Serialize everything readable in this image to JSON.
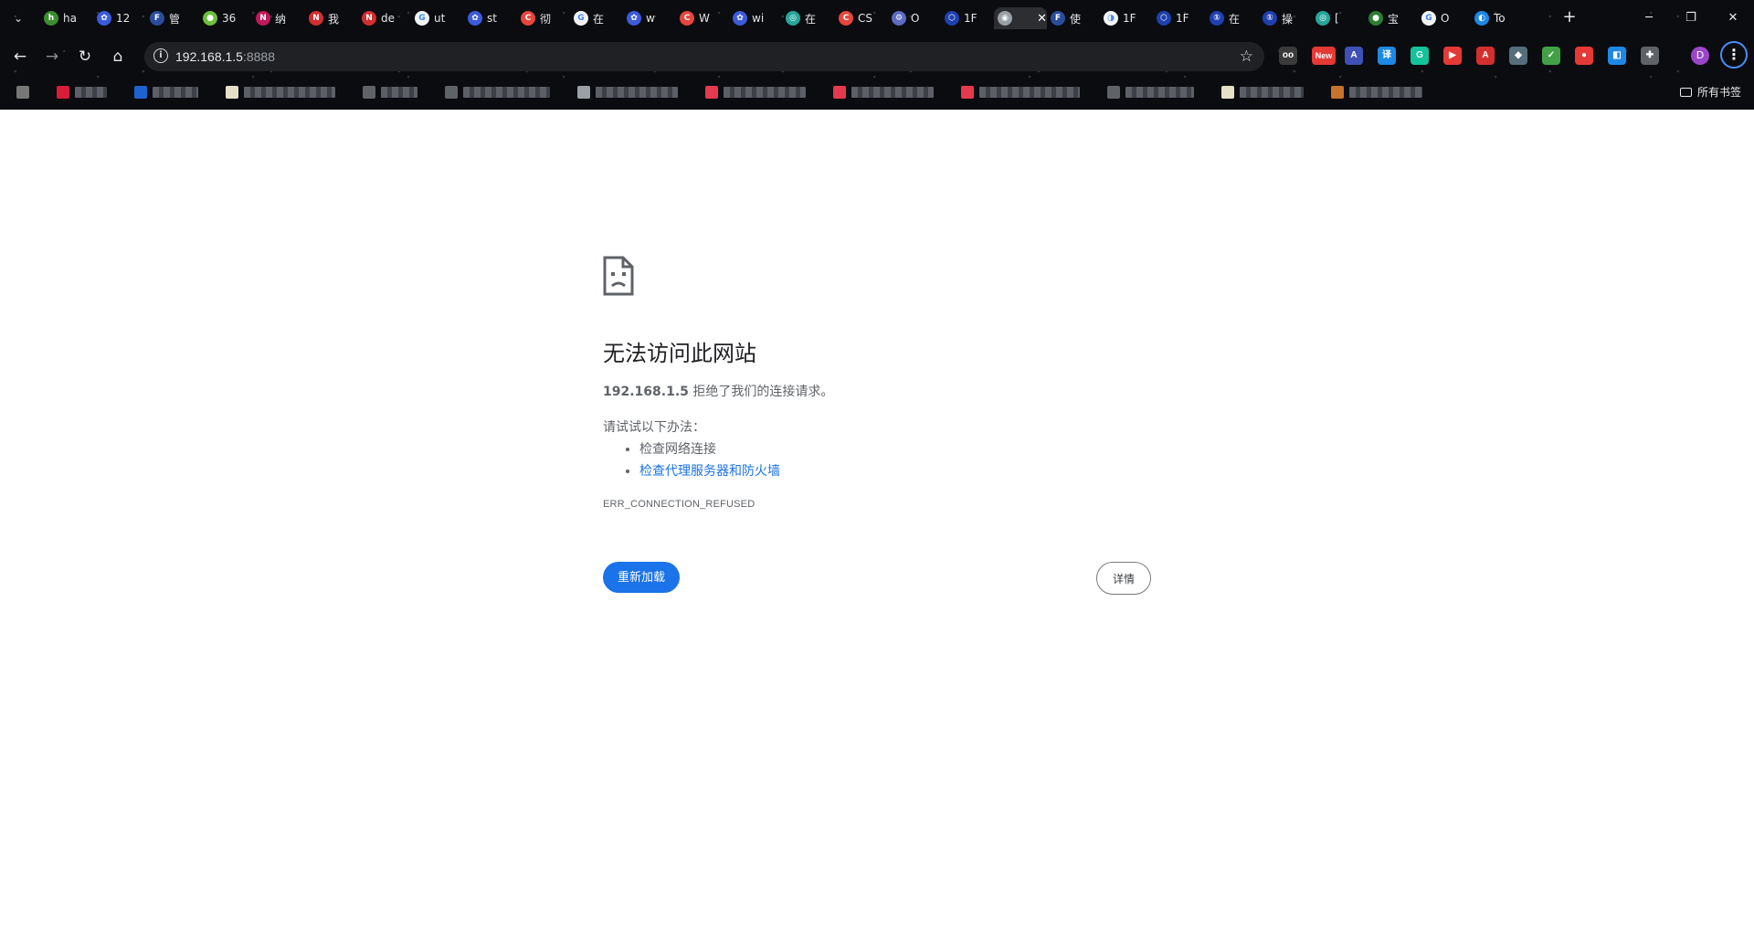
{
  "window": {
    "minimize_icon": "─",
    "restore_icon": "❐",
    "close_icon": "✕"
  },
  "tabs": [
    {
      "title": "ha",
      "color": "#3c8d2f",
      "glyph": "h"
    },
    {
      "title": "12",
      "color": "#3b5bdb",
      "glyph": "✿"
    },
    {
      "title": "管",
      "color": "#2a4d9b",
      "glyph": "F"
    },
    {
      "title": "36",
      "color": "#6bbf3b",
      "glyph": "●"
    },
    {
      "title": "纳",
      "color": "#c2185b",
      "glyph": "N"
    },
    {
      "title": "我",
      "color": "#d32f2f",
      "glyph": "N"
    },
    {
      "title": "de",
      "color": "#d32f2f",
      "glyph": "N"
    },
    {
      "title": "ut",
      "color": "#f1f3f4",
      "glyph": "G"
    },
    {
      "title": "st",
      "color": "#3b5bdb",
      "glyph": "✿"
    },
    {
      "title": "彻",
      "color": "#e8453c",
      "glyph": "C"
    },
    {
      "title": "在",
      "color": "#f1f3f4",
      "glyph": "G"
    },
    {
      "title": "w",
      "color": "#3b5bdb",
      "glyph": "✿"
    },
    {
      "title": "W",
      "color": "#e8453c",
      "glyph": "C"
    },
    {
      "title": "wi",
      "color": "#3b5bdb",
      "glyph": "✿"
    },
    {
      "title": "在",
      "color": "#26a69a",
      "glyph": "◎"
    },
    {
      "title": "CS",
      "color": "#e8453c",
      "glyph": "C"
    },
    {
      "title": "O",
      "color": "#5c6bc0",
      "glyph": "⚙"
    },
    {
      "title": "1F",
      "color": "#1e40af",
      "glyph": "⬡"
    },
    {
      "title": "",
      "color": "#9aa0a6",
      "glyph": "◉",
      "active": true
    },
    {
      "title": "使",
      "color": "#2a4d9b",
      "glyph": "F"
    },
    {
      "title": "1F",
      "color": "#f1f3f4",
      "glyph": "◑"
    },
    {
      "title": "1F",
      "color": "#1e40af",
      "glyph": "⬡"
    },
    {
      "title": "在",
      "color": "#1e40af",
      "glyph": "①"
    },
    {
      "title": "操",
      "color": "#1e40af",
      "glyph": "①"
    },
    {
      "title": "[",
      "color": "#26a69a",
      "glyph": "◎"
    },
    {
      "title": "宝",
      "color": "#2e7d32",
      "glyph": "●"
    },
    {
      "title": "O",
      "color": "#f1f3f4",
      "glyph": "G"
    },
    {
      "title": "To",
      "color": "#1e88e5",
      "glyph": "◐"
    }
  ],
  "new_tab_icon": "+",
  "omnibox": {
    "host": "192.168.1.5",
    "port": ":8888"
  },
  "extensions": [
    {
      "glyph": "oo",
      "color": "#3a3a3a"
    },
    {
      "glyph": "New",
      "color": "#e53935"
    },
    {
      "glyph": "A",
      "color": "#3f51b5"
    },
    {
      "glyph": "译",
      "color": "#1e88e5"
    },
    {
      "glyph": "G",
      "color": "#15c39a"
    },
    {
      "glyph": "▶",
      "color": "#e53935"
    },
    {
      "glyph": "A",
      "color": "#d32f2f"
    },
    {
      "glyph": "◆",
      "color": "#546e7a"
    },
    {
      "glyph": "✓",
      "color": "#43a047"
    },
    {
      "glyph": "●",
      "color": "#e53935"
    },
    {
      "glyph": "◧",
      "color": "#1e88e5"
    },
    {
      "glyph": "✚",
      "color": "#5f6368"
    }
  ],
  "profile_initial": "D",
  "bookmarks": {
    "all_label": "所有书签",
    "items": [
      {
        "color": "#777777",
        "w": 0
      },
      {
        "color": "#d81b39",
        "w": 55
      },
      {
        "color": "#1e62d0",
        "w": 70
      },
      {
        "color": "#e6e0c8",
        "w": 120
      },
      {
        "color": "#5f6368",
        "w": 60
      },
      {
        "color": "#5f6368",
        "w": 115
      },
      {
        "color": "#9aa0a6",
        "w": 110
      },
      {
        "color": "#e53950",
        "w": 110
      },
      {
        "color": "#e53950",
        "w": 110
      },
      {
        "color": "#e53950",
        "w": 130
      },
      {
        "color": "#5f6368",
        "w": 95
      },
      {
        "color": "#e6e0c8",
        "w": 90
      },
      {
        "color": "#c6732d",
        "w": 100
      }
    ]
  },
  "error": {
    "title": "无法访问此网站",
    "host": "192.168.1.5",
    "desc_suffix": " 拒绝了我们的连接请求。",
    "try_label": "请试试以下办法：",
    "suggestion_1": "检查网络连接",
    "suggestion_2": "检查代理服务器和防火墙",
    "code": "ERR_CONNECTION_REFUSED",
    "reload_label": "重新加载",
    "details_label": "详情"
  }
}
